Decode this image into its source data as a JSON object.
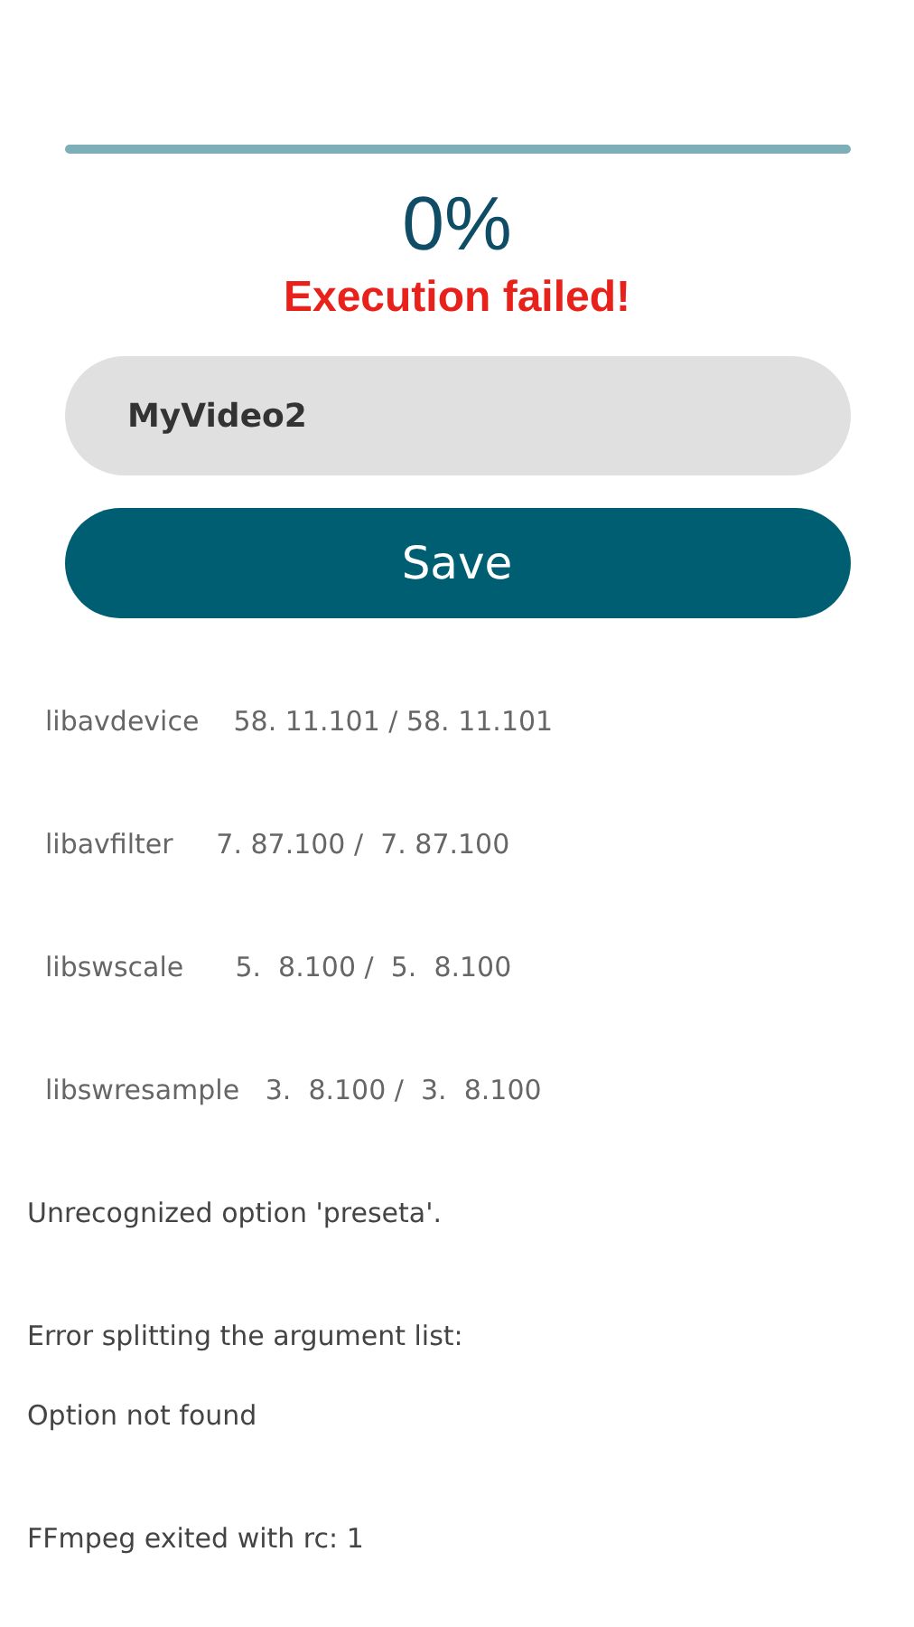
{
  "progress": {
    "level": 0,
    "percent": "0%"
  },
  "status": {
    "text": "Execution failed!",
    "kind": "error"
  },
  "name_field": {
    "value": "MyVideo2"
  },
  "save_button": {
    "label": "Save"
  },
  "log": [
    {
      "kind": "version",
      "lines": [
        "libavdevice    58. 11.101 / 58. 11.101"
      ]
    },
    {
      "kind": "version",
      "lines": [
        "libavfilter     7. 87.100 /  7. 87.100"
      ]
    },
    {
      "kind": "version",
      "lines": [
        "libswscale      5.  8.100 /  5.  8.100"
      ]
    },
    {
      "kind": "version",
      "lines": [
        "libswresample   3.  8.100 /  3.  8.100"
      ]
    },
    {
      "kind": "message",
      "lines": [
        "Unrecognized option 'preseta'."
      ]
    },
    {
      "kind": "message",
      "lines": [
        "Error splitting the argument list:",
        "Option not found"
      ]
    },
    {
      "kind": "message",
      "lines": [
        "FFmpeg exited with rc: 1"
      ]
    }
  ]
}
